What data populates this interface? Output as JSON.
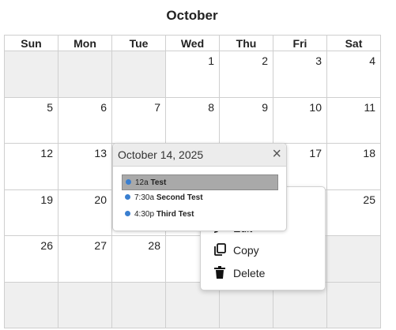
{
  "calendar": {
    "month_title": "October",
    "weekdays": [
      "Sun",
      "Mon",
      "Tue",
      "Wed",
      "Thu",
      "Fri",
      "Sat"
    ],
    "weeks": [
      [
        "",
        "",
        "",
        "1",
        "2",
        "3",
        "4"
      ],
      [
        "5",
        "6",
        "7",
        "8",
        "9",
        "10",
        "11"
      ],
      [
        "12",
        "13",
        "",
        "",
        "",
        "17",
        "18"
      ],
      [
        "19",
        "20",
        "",
        "",
        "",
        "",
        "25"
      ],
      [
        "26",
        "27",
        "28",
        "",
        "",
        "",
        ""
      ],
      [
        "",
        "",
        "",
        "",
        "",
        "",
        ""
      ]
    ]
  },
  "day_popup": {
    "date_title": "October 14, 2025",
    "close_icon": "×",
    "events": [
      {
        "time": "12a",
        "title": "Test",
        "selected": true
      },
      {
        "time": "7:30a",
        "title": "Second Test",
        "selected": false
      },
      {
        "time": "4:30p",
        "title": "Third Test",
        "selected": false
      }
    ],
    "event_dot_color": "#3a7fd0"
  },
  "context_menu": {
    "items": [
      {
        "label": "Edit",
        "icon": "pencil-icon"
      },
      {
        "label": "Copy",
        "icon": "copy-icon"
      },
      {
        "label": "Delete",
        "icon": "trash-icon"
      }
    ]
  }
}
